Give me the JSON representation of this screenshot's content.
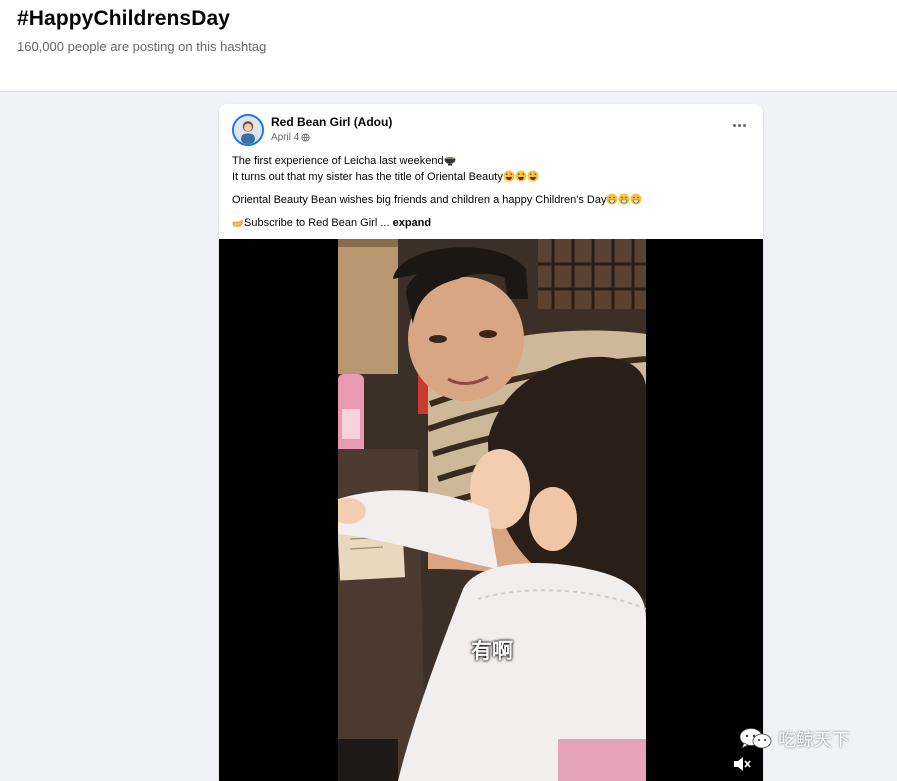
{
  "hashtag": {
    "title": "#HappyChildrensDay",
    "subtitle": "160,000 people are posting on this hashtag"
  },
  "post": {
    "author": "Red Bean Girl (Adou)",
    "date": "April 4",
    "privacy_icon": "globe-icon",
    "more_icon": "more-dots-icon",
    "lines": {
      "line1": "The first experience of Leicha last weekend",
      "line2": "It turns out that my sister has the title of Oriental Beauty",
      "line3": "Oriental Beauty Bean wishes big friends and children a happy Children's Day",
      "line4_prefix": "Subscribe to Red Bean Girl ...",
      "expand_label": "expand"
    },
    "emoji": {
      "line1": "bowl-emoji",
      "line2": "laughing-emoji",
      "line3": "grinning-emoji",
      "line4": "pointing-hand-emoji"
    },
    "video": {
      "subtitle": "有啊",
      "mute_icon": "speaker-muted-icon"
    }
  },
  "watermark": {
    "text": "吃鲸天下",
    "icon": "wechat-icon"
  },
  "colors": {
    "page_bg": "#f0f2f5",
    "card_bg": "#ffffff",
    "accent": "#1877f2",
    "secondary_text": "#65676b",
    "video_bg": "#000000"
  }
}
